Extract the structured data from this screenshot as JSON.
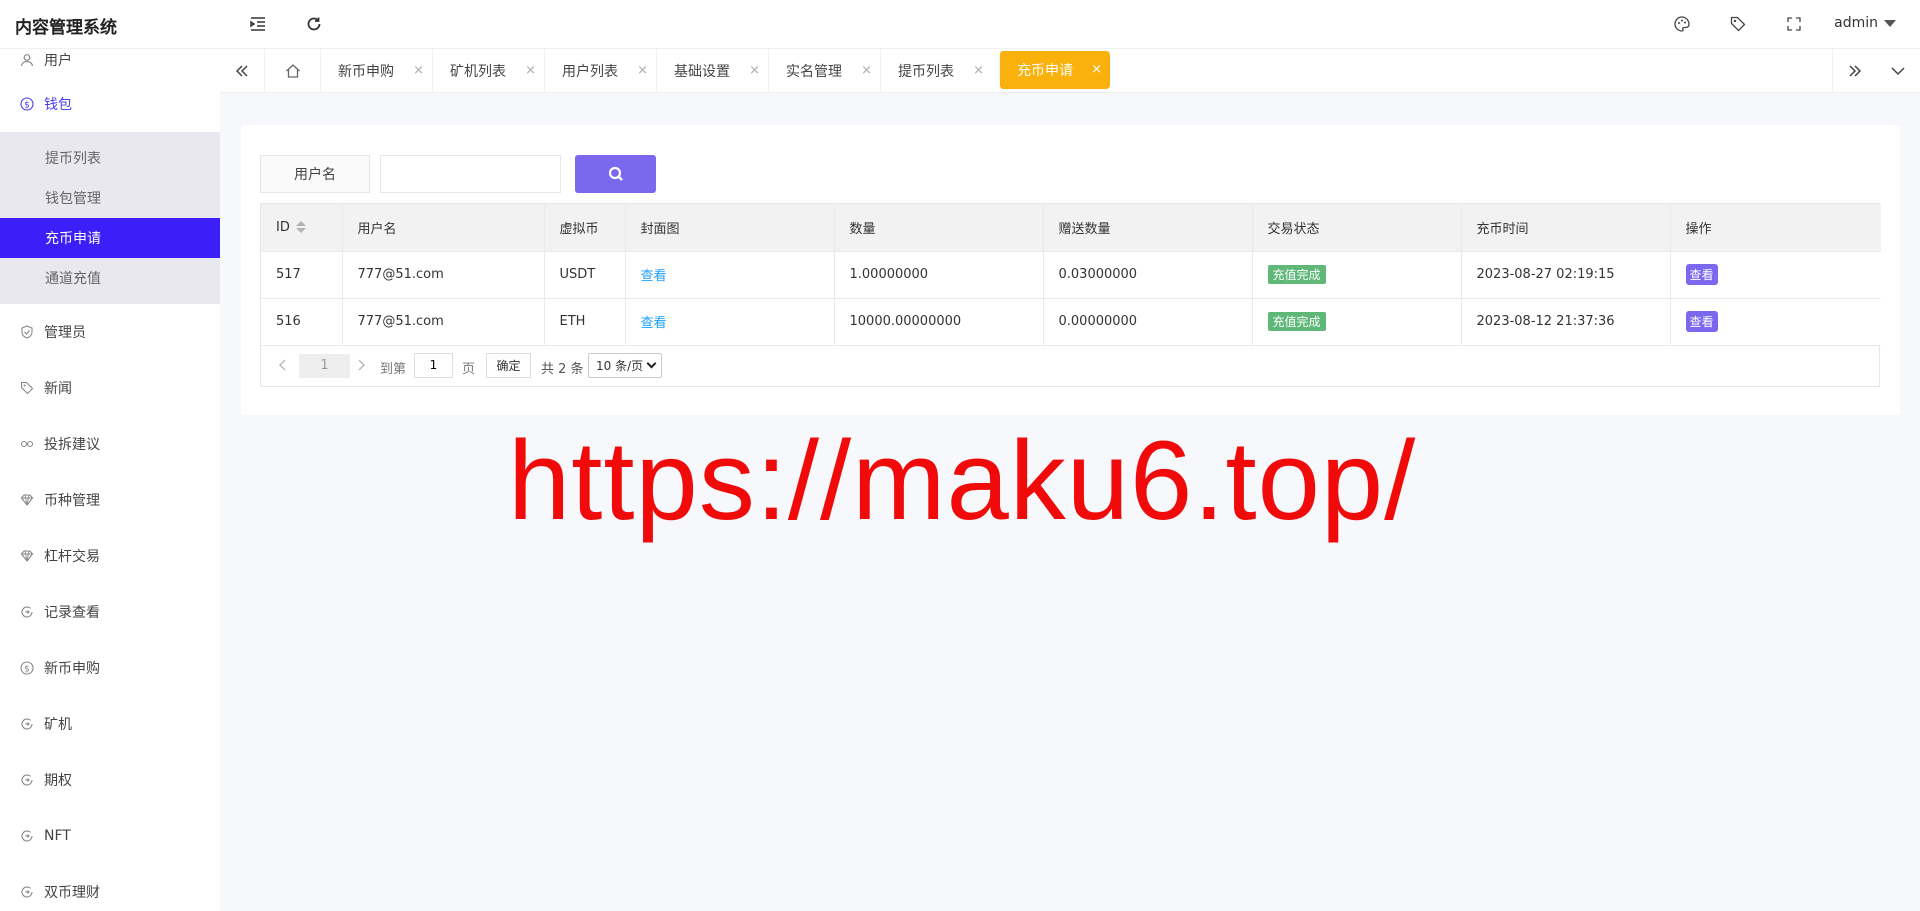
{
  "app": {
    "title": "内容管理系统",
    "user": "admin"
  },
  "colors": {
    "accent": "#3b1ef8",
    "active_tab": "#fbb10b",
    "search_button": "#7b68ee",
    "status_badge": "#5fb878",
    "watermark": "#f10a0a"
  },
  "sidebar": {
    "items": [
      {
        "label": "用户",
        "icon": "user-icon"
      },
      {
        "label": "钱包",
        "icon": "dollar-circle-icon",
        "open": true,
        "children": [
          {
            "label": "提币列表"
          },
          {
            "label": "钱包管理"
          },
          {
            "label": "充币申请",
            "active": true
          },
          {
            "label": "通道充值"
          }
        ]
      },
      {
        "label": "管理员",
        "icon": "shield-icon"
      },
      {
        "label": "新闻",
        "icon": "tag-icon"
      },
      {
        "label": "投拆建议",
        "icon": "link-icon"
      },
      {
        "label": "币种管理",
        "icon": "diamond-icon"
      },
      {
        "label": "杠杆交易",
        "icon": "diamond-icon"
      },
      {
        "label": "记录查看",
        "icon": "circle-arrow-icon"
      },
      {
        "label": "新币申购",
        "icon": "dollar-circle-icon"
      },
      {
        "label": "矿机",
        "icon": "circle-arrow-icon"
      },
      {
        "label": "期权",
        "icon": "circle-arrow-icon"
      },
      {
        "label": "NFT",
        "icon": "circle-arrow-icon"
      },
      {
        "label": "双币理财",
        "icon": "circle-arrow-icon"
      }
    ]
  },
  "tabs": [
    {
      "label": "新币申购"
    },
    {
      "label": "矿机列表"
    },
    {
      "label": "用户列表"
    },
    {
      "label": "基础设置"
    },
    {
      "label": "实名管理"
    },
    {
      "label": "提币列表"
    },
    {
      "label": "充币申请",
      "active": true
    }
  ],
  "tab_close_glyph": "×",
  "search": {
    "label": "用户名",
    "value": ""
  },
  "table": {
    "columns": [
      "ID",
      "用户名",
      "虚拟币",
      "封面图",
      "数量",
      "赠送数量",
      "交易状态",
      "充币时间",
      "操作"
    ],
    "rows": [
      {
        "id": "517",
        "username": "777@51.com",
        "coin": "USDT",
        "cover": "查看",
        "amount": "1.00000000",
        "gift": "0.03000000",
        "status": "充值完成",
        "time": "2023-08-27 02:19:15",
        "action": "查看"
      },
      {
        "id": "516",
        "username": "777@51.com",
        "coin": "ETH",
        "cover": "查看",
        "amount": "10000.00000000",
        "gift": "0.00000000",
        "status": "充值完成",
        "time": "2023-08-12 21:37:36",
        "action": "查看"
      }
    ]
  },
  "pagination": {
    "current": "1",
    "goto_prefix": "到第",
    "goto_value": "1",
    "goto_suffix": "页",
    "confirm": "确定",
    "total": "共 2 条",
    "page_size": "10 条/页"
  },
  "watermark": "https://maku6.top/"
}
